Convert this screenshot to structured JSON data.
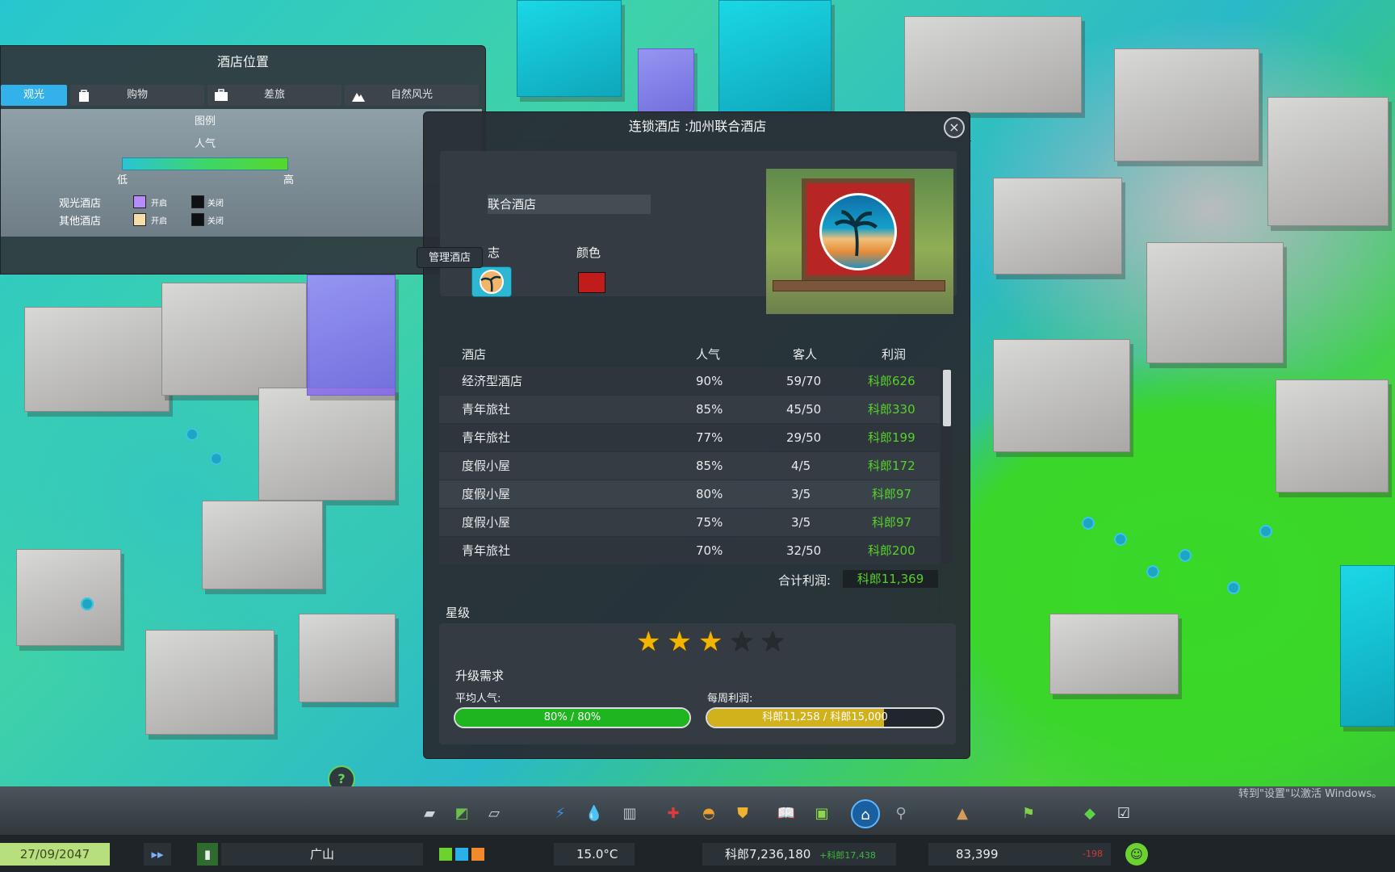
{
  "position_panel": {
    "title": "酒店位置",
    "tabs": [
      {
        "label": "观光",
        "icon": "sightseeing-icon"
      },
      {
        "label": "购物",
        "icon": "shopping-bag-icon"
      },
      {
        "label": "差旅",
        "icon": "briefcase-icon"
      },
      {
        "label": "自然风光",
        "icon": "mountain-icon"
      }
    ],
    "legend_title": "图例",
    "legend_metric": "人气",
    "low_label": "低",
    "high_label": "高",
    "rows": [
      {
        "label": "观光酒店",
        "open_label": "开启",
        "closed_label": "关闭",
        "open_color": "#b48cff"
      },
      {
        "label": "其他酒店",
        "open_label": "开启",
        "closed_label": "关闭",
        "open_color": "#f6deaa"
      }
    ],
    "manage_button": "管理酒店"
  },
  "dialog": {
    "title": "连锁酒店 :加州联合酒店",
    "name_value": "联合酒店",
    "logo_label": "志",
    "color_label": "颜色",
    "logo_color": "#2db7d2",
    "brand_color": "#c01c1c",
    "table": {
      "headers": [
        "酒店",
        "人气",
        "客人",
        "利润"
      ],
      "rows": [
        {
          "name": "经济型酒店",
          "popularity": "90%",
          "guests": "59/70",
          "profit": "科郎626"
        },
        {
          "name": "青年旅社",
          "popularity": "85%",
          "guests": "45/50",
          "profit": "科郎330"
        },
        {
          "name": "青年旅社",
          "popularity": "77%",
          "guests": "29/50",
          "profit": "科郎199"
        },
        {
          "name": "度假小屋",
          "popularity": "85%",
          "guests": "4/5",
          "profit": "科郎172"
        },
        {
          "name": "度假小屋",
          "popularity": "80%",
          "guests": "3/5",
          "profit": "科郎97"
        },
        {
          "name": "度假小屋",
          "popularity": "75%",
          "guests": "3/5",
          "profit": "科郎97"
        },
        {
          "name": "青年旅社",
          "popularity": "70%",
          "guests": "32/50",
          "profit": "科郎200"
        }
      ]
    },
    "total_label": "合计利润:",
    "total_value": "科郎11,369",
    "star_label": "星级",
    "stars_filled": 3,
    "stars_total": 5,
    "upgrade_label": "升级需求",
    "avg_popularity": {
      "label": "平均人气:",
      "text": "80% / 80%",
      "progress": 1.0,
      "color": "#1fb51f"
    },
    "weekly_profit": {
      "label": "每周利润:",
      "text": "科郎11,258 / 科郎15,000",
      "progress": 0.75,
      "color": "#d2b21c"
    }
  },
  "status_bar": {
    "date": "27/09/2047",
    "district": "广山",
    "temperature": "15.0°C",
    "money": "科郎7,236,180",
    "income": "+科郎17,438",
    "population": "83,399",
    "population_change": "-198"
  },
  "watermark": "转到\"设置\"以激活 Windows。",
  "toolbar_icons": [
    "roads-icon",
    "zoning-icon",
    "districts-icon",
    "electricity-icon",
    "water-icon",
    "garbage-icon",
    "healthcare-icon",
    "fire-icon",
    "police-icon",
    "education-icon",
    "public-transport-icon",
    "hotel-icon",
    "monuments-icon",
    "landscaping-icon",
    "money-icon",
    "checklist-icon"
  ],
  "colors": {
    "profit_green": "#56d12b",
    "accent_blue": "#33b1ea",
    "star_gold": "#f4b400"
  }
}
